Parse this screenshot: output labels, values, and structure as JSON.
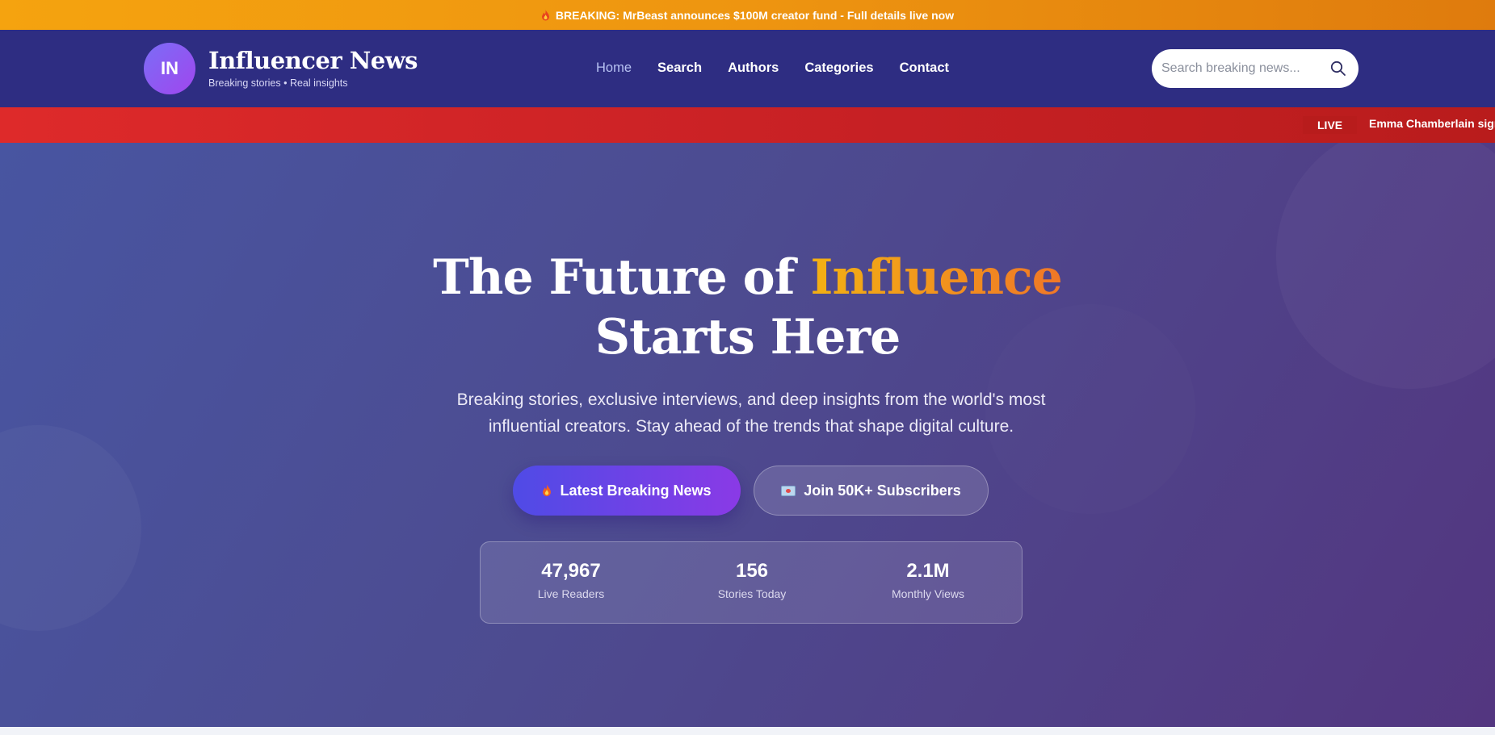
{
  "topbar": {
    "icon": "fire-icon",
    "text": "BREAKING: MrBeast announces $100M creator fund - Full details live now"
  },
  "header": {
    "logo_initials": "IN",
    "brand_name": "Influencer News",
    "tagline": "Breaking stories • Real insights",
    "nav": [
      {
        "label": "Home",
        "active": true
      },
      {
        "label": "Search",
        "active": false
      },
      {
        "label": "Authors",
        "active": false
      },
      {
        "label": "Categories",
        "active": false
      },
      {
        "label": "Contact",
        "active": false
      }
    ],
    "search": {
      "placeholder": "Search breaking news...",
      "value": "",
      "icon": "search-icon"
    }
  },
  "live_ticker": {
    "badge": "LIVE",
    "text": "Emma Chamberlain signs"
  },
  "hero": {
    "title_part1": "The Future of ",
    "title_accent": "Influence",
    "title_part2": "Starts Here",
    "subtitle": "Breaking stories, exclusive interviews, and deep insights from the world's most influential creators. Stay ahead of the trends that shape digital culture.",
    "primary_button": {
      "label": "Latest Breaking News",
      "icon": "fire-icon"
    },
    "secondary_button": {
      "label": "Join 50K+ Subscribers",
      "icon": "mail-icon"
    },
    "stats": [
      {
        "value": "47,967",
        "label": "Live Readers"
      },
      {
        "value": "156",
        "label": "Stories Today"
      },
      {
        "value": "2.1M",
        "label": "Monthly Views"
      }
    ]
  },
  "colors": {
    "topbar": "#f5a30f",
    "header": "#2e2d82",
    "live_bar": "#de2a2a",
    "accent_gradient_start": "#f3b113",
    "accent_gradient_end": "#f07727",
    "primary_button": "#4f4be6"
  }
}
